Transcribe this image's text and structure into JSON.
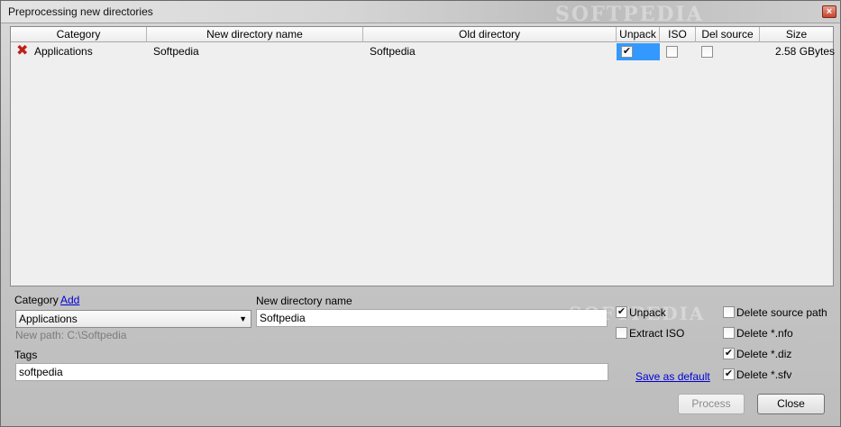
{
  "window": {
    "title": "Preprocessing new directories",
    "close_glyph": "×"
  },
  "list": {
    "columns": [
      "Category",
      "New directory name",
      "Old directory",
      "Unpack",
      "ISO",
      "Del source",
      "Size"
    ],
    "rows": [
      {
        "status_icon": "remove-x-icon",
        "category": "Applications",
        "new_name": "Softpedia",
        "old_dir": "Softpedia",
        "unpack": true,
        "iso": false,
        "del_source": false,
        "size": "2.58 GBytes"
      }
    ]
  },
  "form": {
    "category_label": "Category",
    "add_link": "Add",
    "category_value": "Applications",
    "new_path": "New path: C:\\Softpedia",
    "new_dir_label": "New directory name",
    "new_dir_value": "Softpedia",
    "tags_label": "Tags",
    "tags_value": "softpedia",
    "save_default": "Save as default"
  },
  "options": {
    "unpack": {
      "label": "Unpack",
      "checked": true
    },
    "extract_iso": {
      "label": "Extract ISO",
      "checked": false
    },
    "delete_source_path": {
      "label": "Delete source path",
      "checked": false
    },
    "delete_nfo": {
      "label": "Delete *.nfo",
      "checked": false
    },
    "delete_diz": {
      "label": "Delete *.diz",
      "checked": true
    },
    "delete_sfv": {
      "label": "Delete *.sfv",
      "checked": true
    }
  },
  "buttons": {
    "process": "Process",
    "close": "Close"
  },
  "watermark": {
    "top": "SOFTPEDIA",
    "mid": "SOFTPEDIA"
  },
  "colors": {
    "selection": "#3399ff",
    "link": "#0000d6",
    "delete_icon": "#c0201a"
  }
}
